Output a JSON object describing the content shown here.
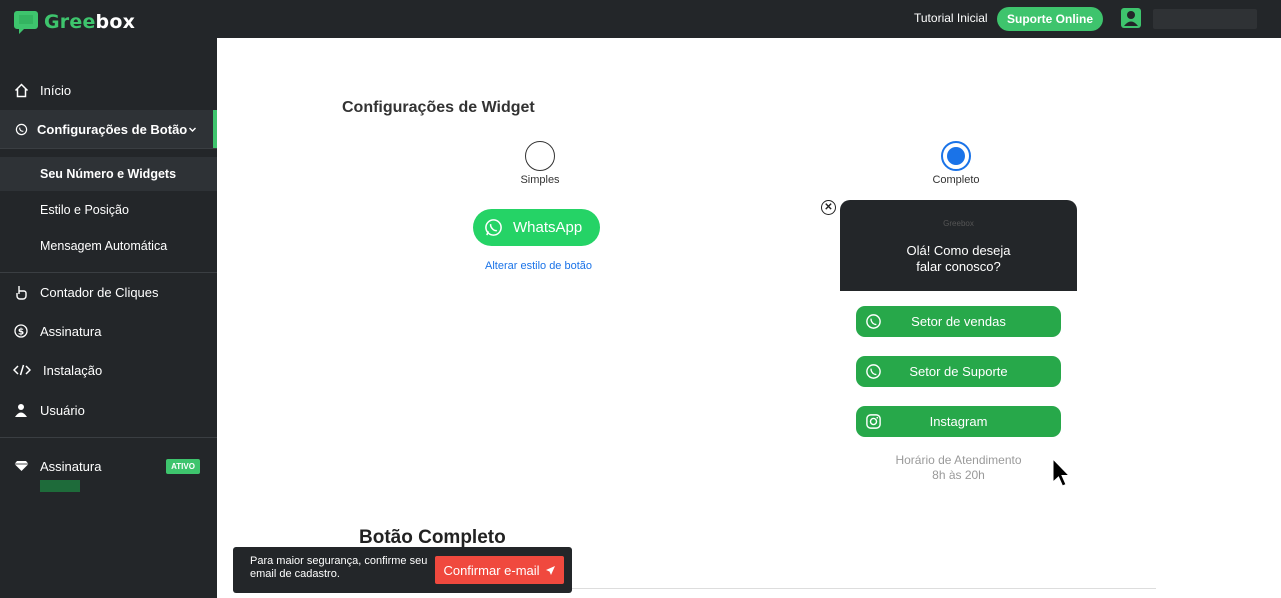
{
  "header": {
    "logo_green": "Gree",
    "logo_white": "box",
    "tutorial": "Tutorial Inicial",
    "suporte": "Suporte Online"
  },
  "sidebar": {
    "inicio": "Início",
    "config_botao": "Configurações de Botão",
    "sub": {
      "numero": "Seu Número e Widgets",
      "estilo": "Estilo e Posição",
      "mensagem": "Mensagem Automática"
    },
    "contador": "Contador de Cliques",
    "assinatura": "Assinatura",
    "instalacao": "Instalação",
    "usuario": "Usuário",
    "assinatura2": "Assinatura",
    "badge": "ATIVO"
  },
  "main": {
    "title": "Configurações de Widget",
    "opt_simples": "Simples",
    "opt_completo": "Completo",
    "selected": "Completo",
    "wa_button": "WhatsApp",
    "alterar": "Alterar estilo de botão",
    "widget": {
      "brand": "Greebox",
      "question_l1": "Olá! Como deseja",
      "question_l2": "falar conosco?",
      "btn1": "Setor de vendas",
      "btn2": "Setor de Suporte",
      "btn3": "Instagram",
      "horario_l1": "Horário de Atendimento",
      "horario_l2": "8h às 20h"
    },
    "card_title": "Botão Completo"
  },
  "toast": {
    "text": "Para maior segurança, confirme seu email de cadastro.",
    "button": "Confirmar e-mail"
  },
  "colors": {
    "brand_green": "#3ec46d",
    "dark": "#232629",
    "whatsapp": "#25d366",
    "link_blue": "#1a73e8",
    "toast_btn": "#f0493e"
  }
}
